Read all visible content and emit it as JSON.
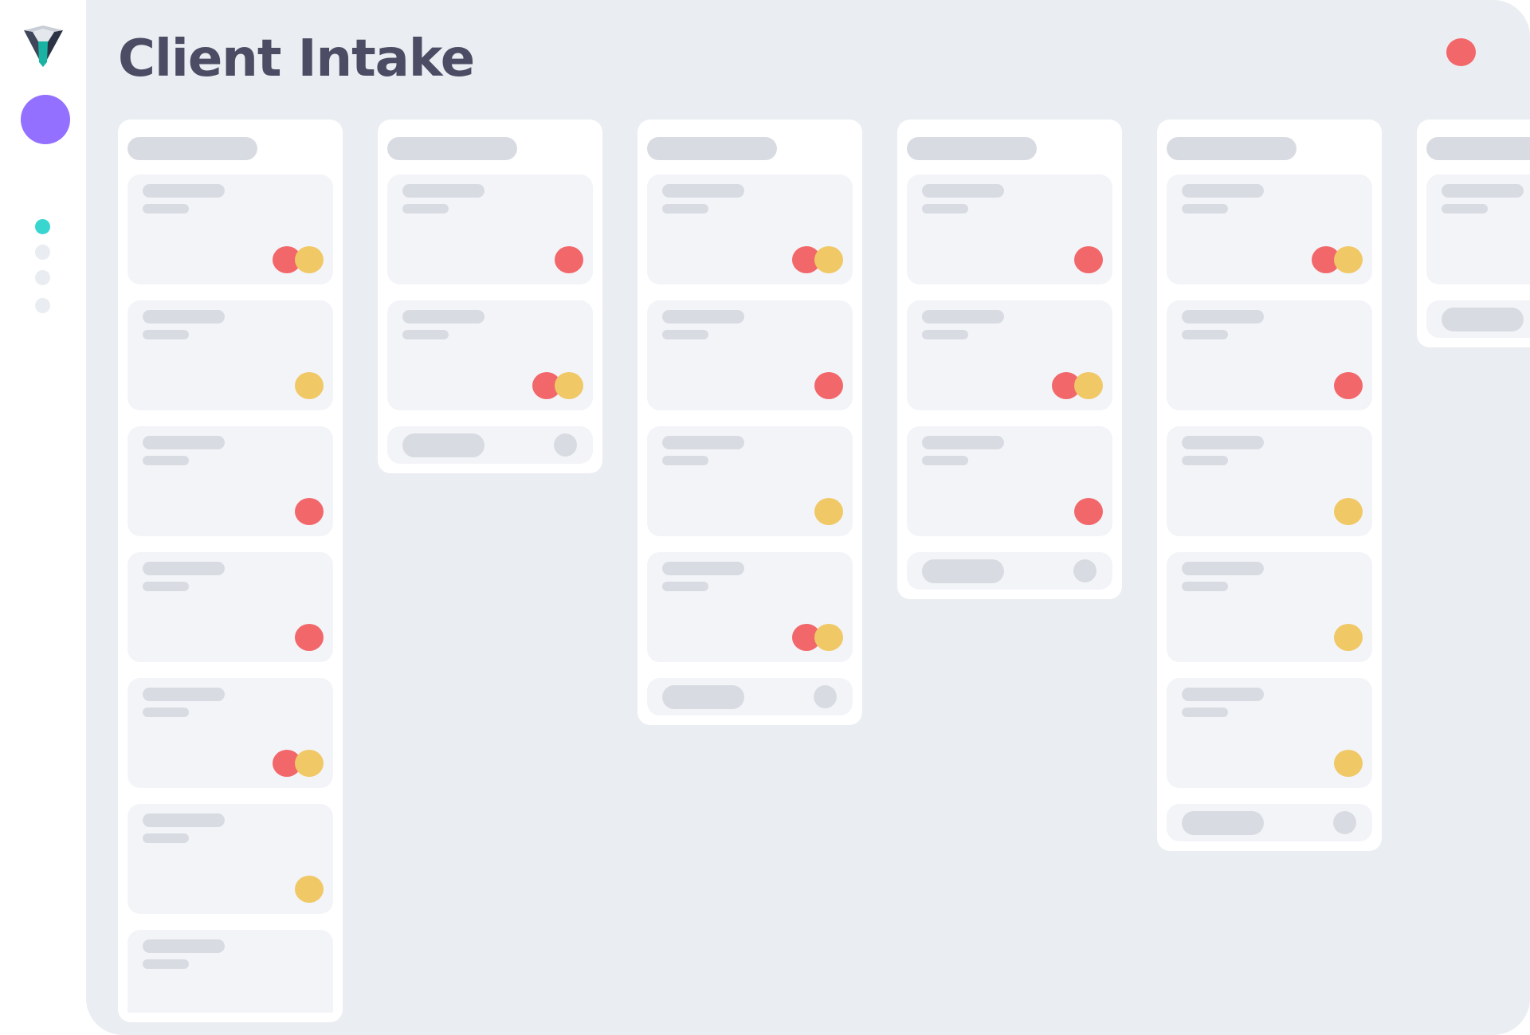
{
  "page": {
    "title": "Client Intake"
  },
  "colors": {
    "red": "#f2676a",
    "yellow": "#f0c865",
    "accent_purple": "#9370ff",
    "accent_teal": "#38d6cf",
    "nav_inactive": "#e9ecf1",
    "title_text": "#4c4d64",
    "placeholder": "#d8dce2",
    "card_bg": "#f3f4f8",
    "canvas_bg": "#eaedf1"
  },
  "icons": {
    "logo": "shield-logo-icon",
    "profile": "avatar",
    "notification": "notification-dot-icon"
  },
  "sidebar": {
    "nav": [
      {
        "name": "nav-dot-1",
        "active": true
      },
      {
        "name": "nav-dot-2",
        "active": false
      },
      {
        "name": "nav-dot-3",
        "active": false
      },
      {
        "name": "nav-dot-4",
        "active": false
      }
    ]
  },
  "board": {
    "columns": [
      {
        "cards": [
          [
            "red",
            "yellow"
          ],
          [
            "yellow"
          ],
          [
            "red"
          ],
          [
            "red"
          ],
          [
            "red",
            "yellow"
          ],
          [
            "yellow"
          ],
          []
        ],
        "footer": false,
        "cut_off": true
      },
      {
        "cards": [
          [
            "red"
          ],
          [
            "red",
            "yellow"
          ]
        ],
        "footer": true
      },
      {
        "cards": [
          [
            "red",
            "yellow"
          ],
          [
            "red"
          ],
          [
            "yellow"
          ],
          [
            "red",
            "yellow"
          ]
        ],
        "footer": true
      },
      {
        "cards": [
          [
            "red"
          ],
          [
            "red",
            "yellow"
          ],
          [
            "red"
          ]
        ],
        "footer": true
      },
      {
        "cards": [
          [
            "red",
            "yellow"
          ],
          [
            "red"
          ],
          [
            "yellow"
          ],
          [
            "yellow"
          ],
          [
            "yellow"
          ]
        ],
        "footer": true
      },
      {
        "cards": [
          []
        ],
        "footer": true
      }
    ]
  }
}
